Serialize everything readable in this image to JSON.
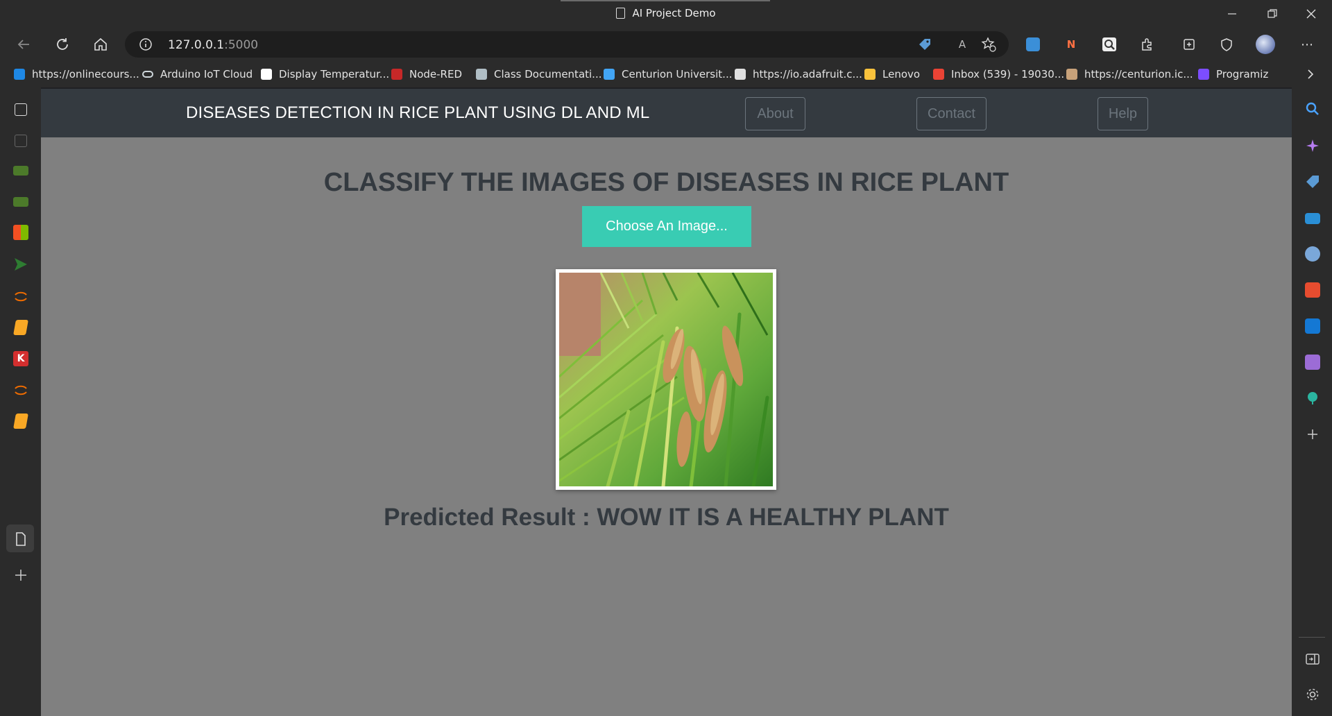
{
  "window": {
    "title": "AI Project Demo"
  },
  "toolbar": {
    "url_host": "127.0.0.1",
    "url_port": ":5000"
  },
  "bookmarks": [
    {
      "label": "https://onlinecours...",
      "color": "#1e88e5"
    },
    {
      "label": "Arduino IoT Cloud",
      "color": "#cfd8dc"
    },
    {
      "label": "Display Temperatur...",
      "color": "#ffffff"
    },
    {
      "label": "Node-RED",
      "color": "#c62828"
    },
    {
      "label": "Class Documentati...",
      "color": "#b0bec5"
    },
    {
      "label": "Centurion Universit...",
      "color": "#42a5f5"
    },
    {
      "label": "https://io.adafruit.c...",
      "color": "#e0e0e0"
    },
    {
      "label": "Lenovo",
      "color": "#f9c23c"
    },
    {
      "label": "Inbox (539) - 19030...",
      "color": "#ea4335"
    },
    {
      "label": "https://centurion.ic...",
      "color": "#c8a27a"
    },
    {
      "label": "Programiz",
      "color": "#7c4dff"
    }
  ],
  "navbar": {
    "brand": "DISEASES DETECTION IN RICE PLANT USING DL AND ML",
    "links": [
      "About",
      "Contact",
      "Help"
    ]
  },
  "main": {
    "heading": "CLASSIFY THE IMAGES OF DISEASES IN RICE PLANT",
    "choose_label": "Choose An Image...",
    "result_text": "Predicted Result : WOW IT IS A HEALTHY PLANT"
  },
  "colors": {
    "page_bg": "#808080",
    "navbar_bg": "#343a40",
    "accent_button": "#39ccb3",
    "text_dark": "#343a40"
  },
  "icons": {
    "left_sidebar": [
      "collections-icon",
      "tab-icon",
      "nvidia-icon",
      "nvidia-icon",
      "microsoft-icon",
      "send-icon",
      "orange-arc-icon",
      "book-icon",
      "k-app-icon",
      "orange-arc-icon",
      "book-icon",
      "page-icon",
      "add-icon"
    ],
    "right_sidebar": [
      "search-icon",
      "copilot-icon",
      "shopping-icon",
      "tools-icon",
      "games-icon",
      "office-icon",
      "outlook-icon",
      "drop-icon",
      "tree-icon",
      "add-icon",
      "split-icon",
      "settings-icon"
    ]
  }
}
